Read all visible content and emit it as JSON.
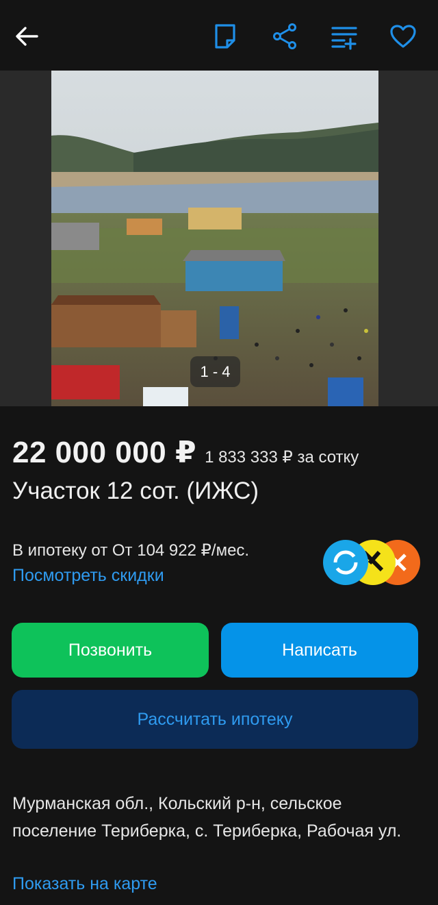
{
  "header": {
    "back_icon": "arrow-left-icon",
    "actions": [
      "note-icon",
      "share-icon",
      "compare-icon",
      "heart-icon"
    ],
    "accent_color": "#1f8fe8"
  },
  "gallery": {
    "counter": "1 - 4"
  },
  "listing": {
    "price": "22 000 000 ₽",
    "price_per_unit": "1 833 333 ₽ за сотку",
    "title": "Участок 12 сот. (ИЖС)"
  },
  "mortgage": {
    "text": "В ипотеку от От 104 922 ₽/мес.",
    "discounts_link": "Посмотреть скидки",
    "bank_logos": [
      "bank-logo-blue",
      "bank-logo-yellow",
      "bank-logo-orange"
    ]
  },
  "actions": {
    "call_label": "Позвонить",
    "write_label": "Написать",
    "mortgage_label": "Рассчитать ипотеку"
  },
  "location": {
    "address": "Мурманская обл., Кольский р-н, сельское поселение Териберка, с. Териберка, Рабочая ул.",
    "map_link": "Показать на карте"
  }
}
